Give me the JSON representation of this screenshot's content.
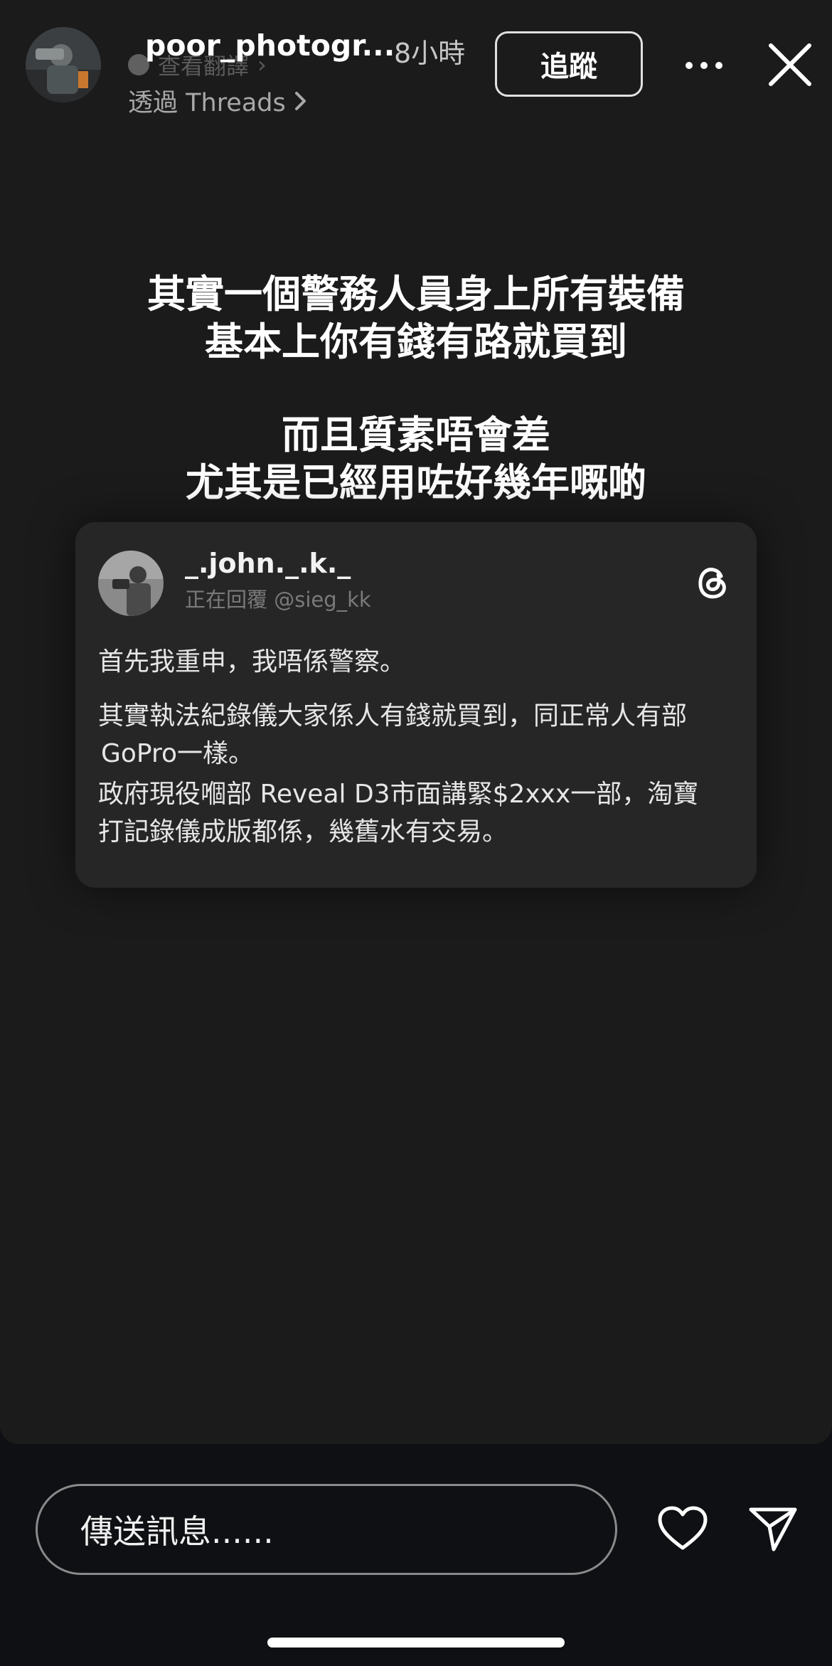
{
  "header": {
    "username": "poor_photogr...",
    "time": "8小時",
    "translate": "查看翻譯",
    "via": "透過 Threads",
    "follow_label": "追蹤"
  },
  "caption": {
    "line1": "其實一個警務人員身上所有裝備",
    "line2": "基本上你有錢有路就買到",
    "line3": "而且質素唔會差",
    "line4": "尤其是已經用咗好幾年嘅啲"
  },
  "card": {
    "username": "_.john._.k._",
    "reply": "正在回覆 @sieg_kk",
    "p1": "首先我重申，我唔係警察。",
    "p2_line1": "其實執法紀錄儀大家係人有錢就買到，同正常人有部",
    "p2_line2": "GoPro一樣。",
    "p3_line1": "政府現役嗰部 Reveal D3市面講緊$2xxx一部，淘寶",
    "p3_line2": "打記錄儀成版都係，幾舊水有交易。"
  },
  "bottom": {
    "message_placeholder": "傳送訊息......"
  }
}
